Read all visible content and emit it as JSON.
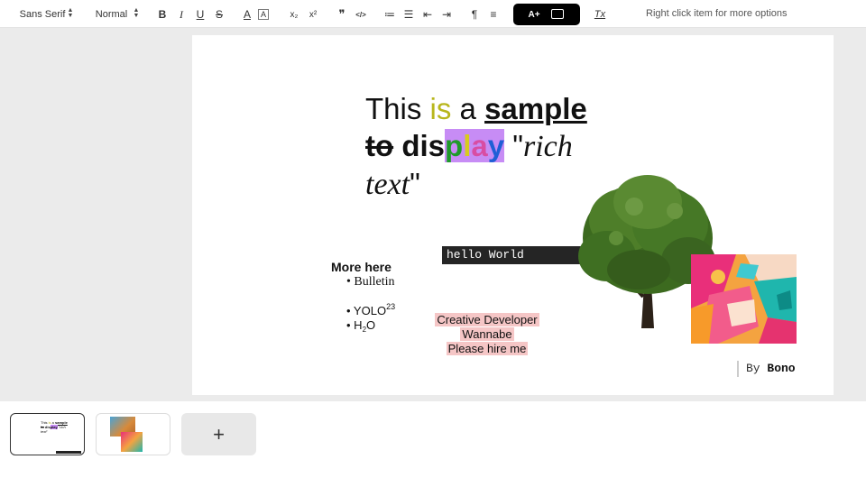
{
  "toolbar": {
    "font_family": "Sans Serif",
    "font_size": "Normal",
    "hint": "Right click item for more options",
    "icons": {
      "bold": "B",
      "italic": "I",
      "underline": "U",
      "strike": "S",
      "text_color": "A",
      "highlight": "A",
      "subscript": "x₂",
      "superscript": "x²",
      "quote": "❞",
      "code": "</>",
      "ordered_list": "≔",
      "bullet_list": "☰",
      "outdent": "⇤",
      "indent": "⇥",
      "rtl": "¶",
      "align": "≡",
      "add_text": "A+",
      "add_image": "🖼",
      "clear_format": "Tx"
    }
  },
  "slide": {
    "title": {
      "w1": "This ",
      "is": "is",
      "w2": " a ",
      "sample": "sample",
      "to": "to",
      "dis": " dis",
      "p": "p",
      "l": "l",
      "a": "a",
      "y": "y",
      "q1": " \"",
      "rich": "rich",
      "text": "text",
      "q2": "\""
    },
    "more_here": "More here",
    "bullets": {
      "b1": "• Bulletin",
      "b2_text": "• YOLO",
      "b2_sup": "23",
      "b3_text": "• H",
      "b3_sub": "2",
      "b3_end": "O"
    },
    "code_box": "hello World",
    "creative": {
      "line1": "Creative Developer",
      "line2": "Wannabe",
      "line3": "Please hire me"
    },
    "byline": {
      "by": "By ",
      "name": "Bono"
    },
    "tree_image": "tree",
    "painting_image": "abstract-painting"
  },
  "thumbnails": {
    "add_label": "+"
  },
  "colors": {
    "is": "#b8b61c",
    "play_bg": "#c78cf5",
    "code_bg": "#252525",
    "creative_bg": "#f5c6c6"
  }
}
